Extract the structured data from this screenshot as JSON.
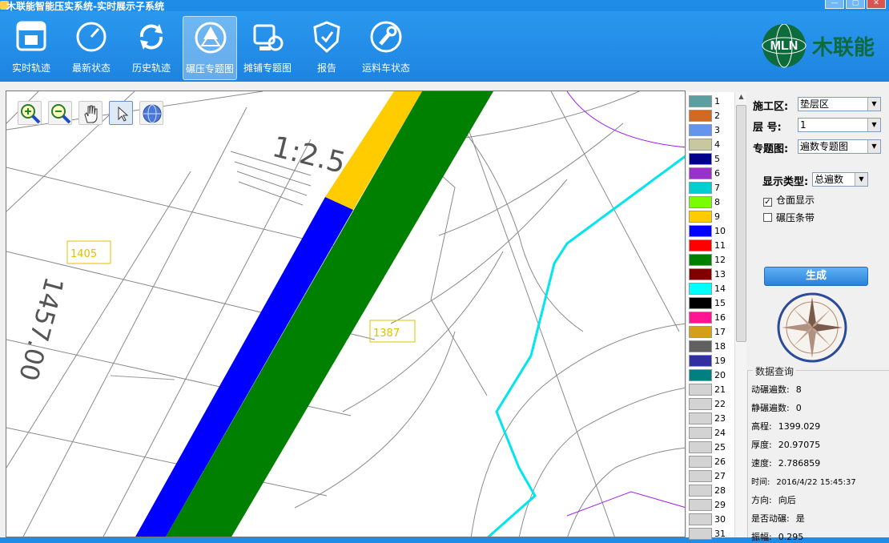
{
  "window": {
    "title": "木联能智能压实系统-实时展示子系统",
    "min": "—",
    "max": "▢"
  },
  "toolbar": {
    "items": [
      {
        "label": "实时轨迹"
      },
      {
        "label": "最新状态"
      },
      {
        "label": "历史轨迹"
      },
      {
        "label": "碾压专题图"
      },
      {
        "label": "摊铺专题图"
      },
      {
        "label": "报告"
      },
      {
        "label": "运料车状态"
      }
    ],
    "active_index": 3
  },
  "logo": {
    "badge": "MLN",
    "text": "木联能"
  },
  "map": {
    "slope_label": "1:2.5",
    "elev_label": "1457.00",
    "boxes": [
      "1405",
      "1387"
    ]
  },
  "legend": {
    "items": [
      {
        "n": "1",
        "color": "#5f9ea0"
      },
      {
        "n": "2",
        "color": "#d2691e"
      },
      {
        "n": "3",
        "color": "#6495ed"
      },
      {
        "n": "4",
        "color": "#c8c8a0"
      },
      {
        "n": "5",
        "color": "#00008b"
      },
      {
        "n": "6",
        "color": "#9932cc"
      },
      {
        "n": "7",
        "color": "#00ced1"
      },
      {
        "n": "8",
        "color": "#7cfc00"
      },
      {
        "n": "9",
        "color": "#ffcc00"
      },
      {
        "n": "10",
        "color": "#0000ff"
      },
      {
        "n": "11",
        "color": "#ff0000"
      },
      {
        "n": "12",
        "color": "#008000"
      },
      {
        "n": "13",
        "color": "#800000"
      },
      {
        "n": "14",
        "color": "#00ffff"
      },
      {
        "n": "15",
        "color": "#000000"
      },
      {
        "n": "16",
        "color": "#ff1493"
      },
      {
        "n": "17",
        "color": "#d4a017"
      },
      {
        "n": "18",
        "color": "#606060"
      },
      {
        "n": "19",
        "color": "#3030a0"
      },
      {
        "n": "20",
        "color": "#008080"
      },
      {
        "n": "21",
        "color": "#d3d3d3"
      },
      {
        "n": "22",
        "color": "#d3d3d3"
      },
      {
        "n": "23",
        "color": "#d3d3d3"
      },
      {
        "n": "24",
        "color": "#d3d3d3"
      },
      {
        "n": "25",
        "color": "#d3d3d3"
      },
      {
        "n": "26",
        "color": "#d3d3d3"
      },
      {
        "n": "27",
        "color": "#d3d3d3"
      },
      {
        "n": "28",
        "color": "#d3d3d3"
      },
      {
        "n": "29",
        "color": "#d3d3d3"
      },
      {
        "n": "30",
        "color": "#d3d3d3"
      },
      {
        "n": "31",
        "color": "#d3d3d3"
      }
    ]
  },
  "panel": {
    "zone_label": "施工区:",
    "zone_value": "垫层区",
    "layer_label": "层  号:",
    "layer_value": "1",
    "theme_label": "专题图:",
    "theme_value": "遍数专题图",
    "display_label": "显示类型:",
    "display_value": "总遍数",
    "chk_surface": "仓面显示",
    "chk_strip": "碾压条带",
    "generate": "生成",
    "query_title": "数据查询",
    "q_dyn": {
      "k": "动碾遍数:",
      "v": "8"
    },
    "q_static": {
      "k": "静碾遍数:",
      "v": "0"
    },
    "q_elev": {
      "k": "高程:",
      "v": "1399.029"
    },
    "q_thick": {
      "k": "厚度:",
      "v": "20.97075"
    },
    "q_speed": {
      "k": "速度:",
      "v": "2.786859"
    },
    "q_time": {
      "k": "时间:",
      "v": "2016/4/22 15:45:37"
    },
    "q_dir": {
      "k": "方向:",
      "v": "向后"
    },
    "q_vib": {
      "k": "是否动碾:",
      "v": "是"
    },
    "q_amp": {
      "k": "振幅:",
      "v": "0.295"
    }
  }
}
